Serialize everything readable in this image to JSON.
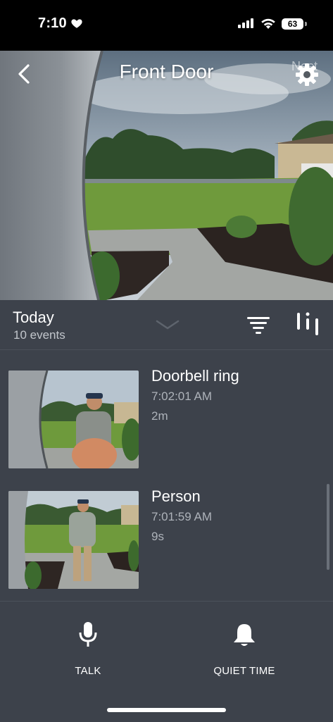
{
  "status_bar": {
    "time": "7:10",
    "battery": "63"
  },
  "camera": {
    "title": "Front Door",
    "brand_overlay": "Nest"
  },
  "summary": {
    "day": "Today",
    "count": "10 events"
  },
  "events": [
    {
      "title": "Doorbell ring",
      "time": "7:02:01 AM",
      "duration": "2m"
    },
    {
      "title": "Person",
      "time": "7:01:59 AM",
      "duration": "9s"
    }
  ],
  "actions": {
    "talk": "TALK",
    "quiet_time": "QUIET TIME"
  },
  "colors": {
    "background": "#3d424b",
    "status_bar": "#000000",
    "secondary_text": "#aeb3ba"
  },
  "icons": [
    "heart-icon",
    "signal-icon",
    "wifi-icon",
    "battery-icon",
    "back-arrow-icon",
    "gear-icon",
    "chevron-down-icon",
    "filter-icon",
    "timeline-icon",
    "microphone-icon",
    "bell-icon"
  ]
}
